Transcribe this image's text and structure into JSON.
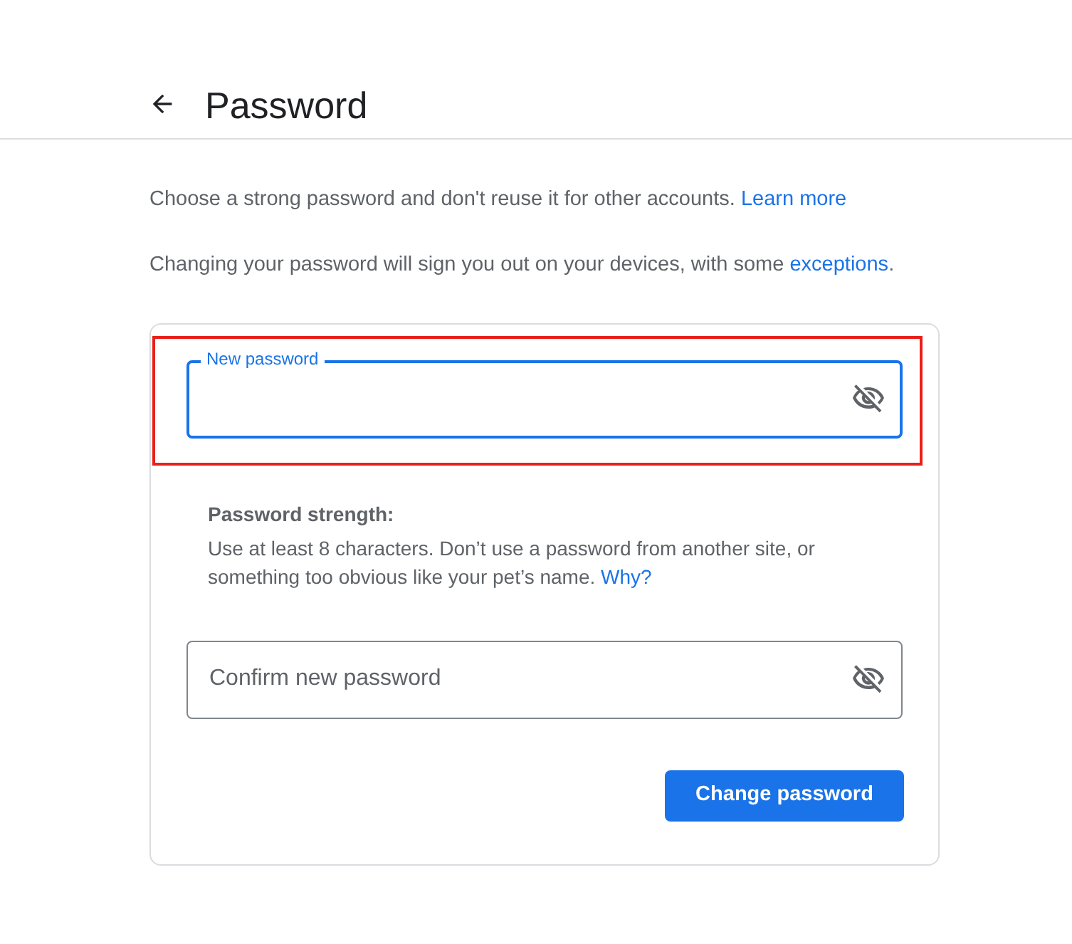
{
  "header": {
    "title": "Password"
  },
  "intro": [
    {
      "text": "Choose a strong password and don't reuse it for other accounts. ",
      "link": "Learn more"
    },
    {
      "text": "Changing your password will sign you out on your devices, with some ",
      "link": "exceptions",
      "link_end": "."
    }
  ],
  "new_password": {
    "label": "New password",
    "focused": true,
    "highlighted": true,
    "visible": false
  },
  "strength": {
    "title": "Password strength:",
    "text": "Use at least 8 characters. Don’t use a password from another site, or something too obvious like your pet’s name. ",
    "link": "Why?"
  },
  "confirm_password": {
    "placeholder": "Confirm new password",
    "focused": false,
    "visible": false
  },
  "buttons": [
    {
      "label": "Change password"
    }
  ]
}
